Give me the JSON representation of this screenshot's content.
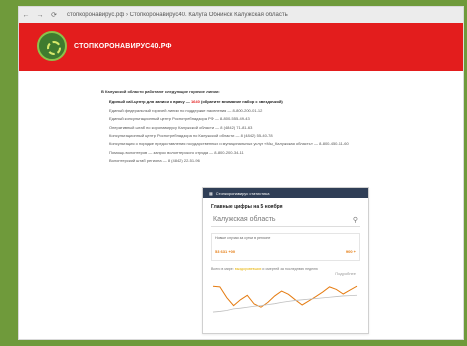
{
  "browser": {
    "url": "стопкоронавирус.рф › Стопкоронавирус40. Калуга Обнинск Калужская область"
  },
  "header": {
    "site_title": "СТОПКОРОНАВИРУС40.РФ"
  },
  "content": {
    "intro": "В Калужской области работают следующие горячие линии:",
    "main_item_label": "Единый call-центр для записи к врачу — ",
    "main_item_number": "1640",
    "main_item_suffix": " (обратите внимание набор с звездочкой)",
    "items": [
      "Единый федеральный горячей линии по поддержке населения — 8-800-200-01-12",
      "Единый консультационный центр Роспотребнадзора РФ — 8-800-555-49-43",
      "Оперативный штаб по коронавирусу Калужской области — 8 (4842) 71-81-63",
      "Консультационный центр Роспотребнадзора по Калужской области — 8 (4842) 55-40-78",
      "Консультация о порядке предоставления государственных и муниципальных услуг «Мы_Калужская область» — 8-800-450-11-60",
      "Помощь волонтеров — запрос волонтерского отряда — 8-800-200-34-11",
      "Волонтерский штаб региона — 8 (4842) 22-51-96"
    ]
  },
  "widget": {
    "topbar": "Стопкоронавирус статистика",
    "title": "Главные цифры на 5 ноября",
    "region": "Калужская область",
    "stat_label": "Новые случаи за сутки в регионе",
    "stat_value": "53 631 +00",
    "stat_value_2": "900 +",
    "legend_text": "Всего в мире: ",
    "legend_recovered": "выздоровевших",
    "legend_tail": " и смертей за последнюю неделю",
    "more": "Подробнее"
  },
  "chart_data": {
    "type": "line",
    "series": [
      {
        "values": [
          120,
          118,
          85,
          60,
          78,
          92,
          65,
          55,
          70,
          90,
          105,
          95,
          78,
          62,
          75,
          88,
          102,
          118,
          110,
          96,
          108,
          120
        ]
      },
      {
        "values": [
          40,
          42,
          45,
          50,
          52,
          55,
          58,
          60,
          63,
          66,
          70,
          73,
          76,
          78,
          80,
          82,
          84,
          86,
          88,
          90,
          91,
          92
        ]
      }
    ],
    "colors": [
      "#e57c12",
      "#bfbfbf"
    ],
    "ylim": [
      0,
      130
    ]
  }
}
